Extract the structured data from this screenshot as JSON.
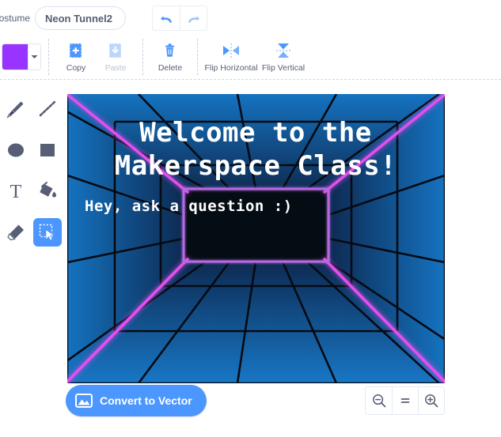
{
  "header": {
    "costume_label": "Costume",
    "name_value": "Neon Tunnel2",
    "undo_icon": "undo-arrow-icon",
    "redo_icon": "redo-arrow-icon"
  },
  "toolbar": {
    "color_swatch_hex": "#9933ff",
    "dropdown_icon": "chevron-down-icon",
    "actions": [
      {
        "label": "Copy",
        "icon": "copy-icon",
        "disabled": false
      },
      {
        "label": "Paste",
        "icon": "paste-icon",
        "disabled": true
      },
      {
        "label": "Delete",
        "icon": "trash-icon",
        "disabled": false
      },
      {
        "label": "Flip Horizontal",
        "icon": "flip-horizontal-icon",
        "disabled": false
      },
      {
        "label": "Flip Vertical",
        "icon": "flip-vertical-icon",
        "disabled": false
      }
    ]
  },
  "tools": [
    {
      "name": "brush",
      "label": "Brush",
      "selected": false
    },
    {
      "name": "line",
      "label": "Line",
      "selected": false
    },
    {
      "name": "ellipse",
      "label": "Ellipse",
      "selected": false
    },
    {
      "name": "rectangle",
      "label": "Rectangle",
      "selected": false
    },
    {
      "name": "text",
      "label": "Text",
      "selected": false
    },
    {
      "name": "fill",
      "label": "Fill",
      "selected": false
    },
    {
      "name": "eraser",
      "label": "Eraser",
      "selected": false
    },
    {
      "name": "select",
      "label": "Select",
      "selected": true
    }
  ],
  "canvas": {
    "title_line1": "Welcome to the",
    "title_line2": "Makerspace Class!",
    "subtitle": "Hey, ask a question  :)",
    "colors": {
      "wall_blue": "#1573c0",
      "wall_blue_dark": "#0f4f88",
      "deep_dark": "#122a4d",
      "void": "#050d14",
      "neon_magenta": "#e44ff0",
      "neon_magenta_soft": "#b565d8",
      "grid_line": "#0a0a14"
    }
  },
  "bottom": {
    "convert_label": "Convert to Vector",
    "convert_icon": "image-icon",
    "zoom_out_icon": "zoom-out-icon",
    "zoom_reset_icon": "zoom-reset-icon",
    "zoom_in_icon": "zoom-in-icon"
  }
}
